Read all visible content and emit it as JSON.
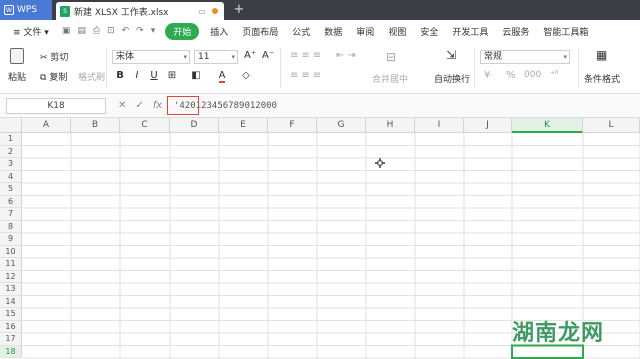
{
  "titlebar": {
    "app_tab": "WPS",
    "doc_tab": "新建 XLSX 工作表.xlsx",
    "new_tab": "+"
  },
  "menubar": {
    "file": "文件",
    "items": [
      "开始",
      "插入",
      "页面布局",
      "公式",
      "数据",
      "审阅",
      "视图",
      "安全",
      "开发工具",
      "云服务",
      "智能工具箱"
    ]
  },
  "ribbon": {
    "paste": "粘贴",
    "cut": "剪切",
    "copy": "复制",
    "format_painter": "格式刷",
    "font": "宋体",
    "font_size": "11",
    "bold": "B",
    "italic": "I",
    "underline": "U",
    "merge": "合并居中",
    "wrap": "自动换行",
    "number_format": "常规",
    "percent": "%",
    "cond_format": "条件格式"
  },
  "formula_bar": {
    "name_box": "K18",
    "fx": "fx",
    "value": "'420123456789012000"
  },
  "columns": [
    "A",
    "B",
    "C",
    "D",
    "E",
    "F",
    "G",
    "H",
    "I",
    "J",
    "K",
    "L"
  ],
  "active_column": "K",
  "rows": [
    "1",
    "2",
    "3",
    "4",
    "5",
    "6",
    "7",
    "8",
    "9",
    "10",
    "11",
    "12",
    "13",
    "14",
    "15",
    "16",
    "17",
    "18"
  ],
  "active_row": "18",
  "watermark": "湖南龙网",
  "colors": {
    "accent_green": "#2eaa52",
    "title_bar": "#3a3f47",
    "highlight_red": "#e0443a"
  }
}
